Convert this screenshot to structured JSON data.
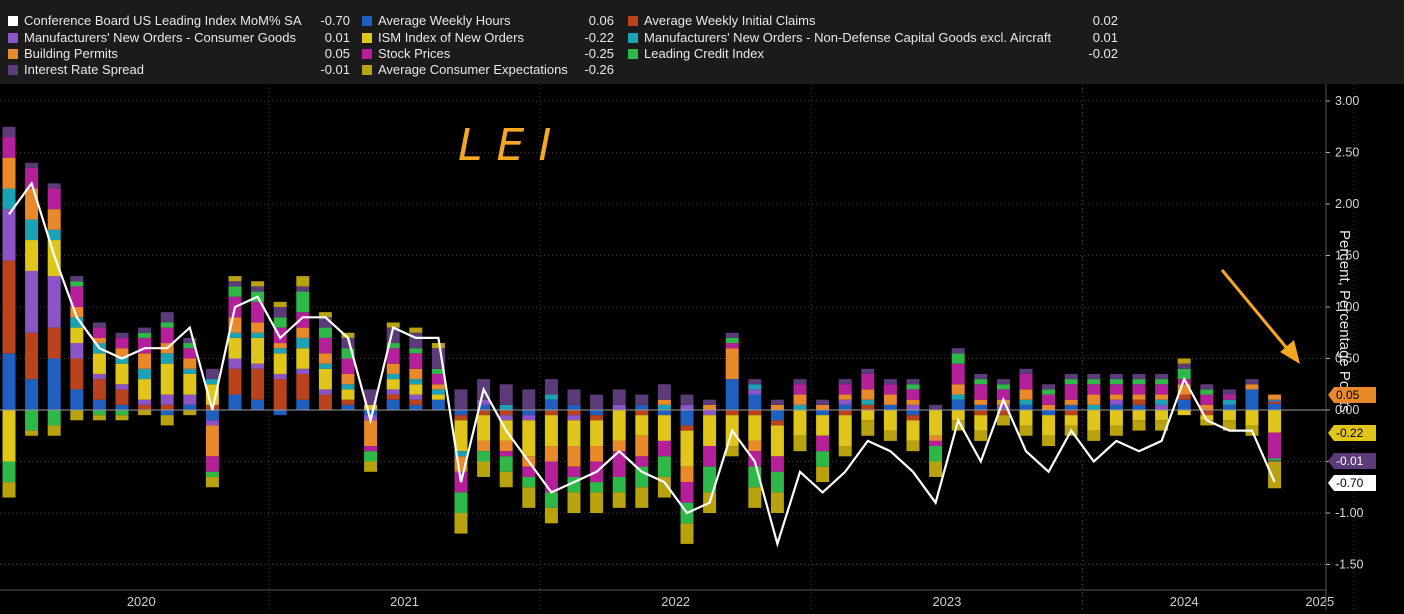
{
  "legend": [
    {
      "name": "Conference Board US Leading Index MoM% SA",
      "value": "-0.70",
      "color": "#ffffff"
    },
    {
      "name": "Average Weekly Hours",
      "value": "0.06",
      "color": "#1f5fbf"
    },
    {
      "name": "Average Weekly Initial Claims",
      "value": "0.02",
      "color": "#b8431c"
    },
    {
      "name": "Manufacturers' New Orders - Consumer Goods",
      "value": "0.01",
      "color": "#8b55c6"
    },
    {
      "name": "ISM Index of New Orders",
      "value": "-0.22",
      "color": "#e0c51a"
    },
    {
      "name": "Manufacturers' New Orders - Non-Defense Capital Goods excl. Aircraft",
      "value": "0.01",
      "color": "#1ba3b5"
    },
    {
      "name": "Building Permits",
      "value": "0.05",
      "color": "#e8892a"
    },
    {
      "name": "Stock Prices",
      "value": "-0.25",
      "color": "#b5209a"
    },
    {
      "name": "Leading Credit Index",
      "value": "-0.02",
      "color": "#2fb84a"
    },
    {
      "name": "Interest Rate Spread",
      "value": "-0.01",
      "color": "#5b3b78"
    },
    {
      "name": "Average Consumer Expectations",
      "value": "-0.26",
      "color": "#b8a20e"
    }
  ],
  "annotation": {
    "text": "LEI",
    "color": "#f5a623"
  },
  "value_tags": [
    {
      "text": "0.05",
      "value": 0.05,
      "bg": "#e8892a",
      "fg": "#000000"
    },
    {
      "text": "-0.22",
      "value": -0.22,
      "bg": "#e0c51a",
      "fg": "#000000"
    },
    {
      "text": "-0.01",
      "value": -0.01,
      "bg": "#5b3b78",
      "fg": "#ffffff"
    },
    {
      "text": "-0.70",
      "value": -0.7,
      "bg": "#ffffff",
      "fg": "#000000"
    }
  ],
  "chart_data": {
    "type": "bar",
    "stacked": true,
    "ylabel": "Percent, Percentage Points",
    "ylim": [
      -1.7,
      3.1
    ],
    "yticks": [
      3.0,
      2.5,
      2.0,
      1.5,
      1.0,
      0.5,
      0.0,
      -0.5,
      -1.0,
      -1.5
    ],
    "ytick_labels": [
      "3.00",
      "2.50",
      "2.00",
      "1.50",
      "1.00",
      "0.50",
      "0.00",
      "-0.50",
      "-1.00",
      "-1.50"
    ],
    "x_start": "2020-01",
    "year_labels": [
      "2020",
      "2021",
      "2022",
      "2023",
      "2024",
      "2025"
    ],
    "grid": true,
    "line": {
      "name": "Conference Board US Leading Index MoM% SA",
      "values": [
        1.9,
        2.2,
        1.5,
        0.9,
        0.6,
        0.5,
        0.6,
        0.6,
        0.8,
        0.0,
        1.0,
        1.1,
        0.7,
        0.9,
        0.9,
        0.7,
        -0.1,
        0.8,
        0.7,
        0.7,
        -0.7,
        0.2,
        -0.2,
        -0.5,
        -0.8,
        -0.7,
        -0.6,
        -0.4,
        -0.6,
        -0.7,
        -1.0,
        -0.9,
        -0.2,
        -0.5,
        -1.3,
        -0.6,
        -0.8,
        -0.6,
        -0.3,
        -0.4,
        -0.6,
        -0.9,
        -0.1,
        -0.5,
        0.1,
        -0.4,
        -0.6,
        -0.2,
        -0.5,
        -0.3,
        -0.4,
        -0.3,
        0.3,
        -0.1,
        -0.2,
        -0.2,
        -0.7
      ]
    },
    "series": [
      {
        "name": "Average Weekly Hours",
        "values": [
          0.55,
          0.3,
          0.5,
          0.2,
          0.1,
          0.05,
          0.0,
          -0.05,
          0.05,
          -0.1,
          0.15,
          0.1,
          -0.05,
          0.1,
          0.0,
          0.05,
          -0.05,
          0.1,
          0.05,
          0.1,
          -0.05,
          0.05,
          0.0,
          -0.05,
          0.1,
          0.05,
          -0.05,
          0.0,
          0.05,
          -0.05,
          -0.15,
          0.0,
          0.3,
          0.15,
          -0.1,
          0.0,
          -0.05,
          0.05,
          0.0,
          0.05,
          -0.05,
          0.0,
          0.1,
          0.05,
          0.0,
          0.05,
          -0.05,
          0.05,
          0.0,
          0.05,
          0.05,
          0.0,
          0.1,
          0.0,
          0.05,
          0.2,
          0.06
        ]
      },
      {
        "name": "Average Weekly Initial Claims",
        "values": [
          0.9,
          0.45,
          0.3,
          0.3,
          0.2,
          0.15,
          0.05,
          0.05,
          0.0,
          0.05,
          0.25,
          0.3,
          0.3,
          0.25,
          0.15,
          0.05,
          0.0,
          0.05,
          0.05,
          0.0,
          -0.05,
          -0.05,
          -0.05,
          0.0,
          -0.05,
          -0.05,
          -0.05,
          0.0,
          -0.05,
          0.0,
          -0.05,
          0.0,
          -0.05,
          -0.05,
          -0.05,
          0.0,
          0.0,
          -0.05,
          0.05,
          0.0,
          -0.05,
          0.0,
          0.0,
          -0.05,
          -0.05,
          0.0,
          0.0,
          -0.05,
          0.0,
          0.0,
          0.05,
          0.0,
          0.05,
          -0.05,
          0.0,
          0.0,
          0.02
        ]
      },
      {
        "name": "Manufacturers' New Orders - Consumer Goods",
        "values": [
          0.5,
          0.6,
          0.5,
          0.15,
          0.05,
          0.05,
          0.05,
          0.1,
          0.1,
          -0.05,
          0.1,
          0.05,
          0.05,
          0.05,
          0.05,
          0.0,
          -0.05,
          0.05,
          0.05,
          0.0,
          0.0,
          0.05,
          -0.05,
          -0.05,
          0.0,
          -0.05,
          0.0,
          0.05,
          0.0,
          0.0,
          0.05,
          -0.05,
          0.0,
          0.05,
          0.0,
          0.0,
          0.0,
          0.05,
          0.0,
          0.0,
          0.05,
          0.0,
          0.0,
          0.0,
          0.05,
          0.0,
          0.0,
          0.0,
          0.0,
          0.05,
          0.0,
          0.05,
          0.0,
          0.0,
          0.0,
          0.0,
          0.01
        ]
      },
      {
        "name": "ISM Index of New Orders",
        "values": [
          -0.5,
          0.3,
          0.35,
          0.15,
          0.2,
          0.2,
          0.2,
          0.3,
          0.2,
          0.2,
          0.2,
          0.25,
          0.2,
          0.2,
          0.2,
          0.1,
          0.05,
          0.1,
          0.1,
          0.05,
          -0.3,
          -0.25,
          -0.2,
          -0.35,
          -0.3,
          -0.25,
          -0.25,
          -0.3,
          -0.2,
          -0.25,
          -0.35,
          -0.3,
          -0.3,
          -0.25,
          -0.3,
          -0.25,
          -0.2,
          -0.3,
          -0.1,
          -0.2,
          -0.2,
          -0.25,
          -0.1,
          -0.15,
          0.0,
          -0.15,
          -0.2,
          -0.1,
          -0.2,
          -0.15,
          -0.1,
          -0.1,
          -0.05,
          -0.05,
          -0.1,
          -0.15,
          -0.22
        ]
      },
      {
        "name": "Manufacturers' New Orders - Non-Defense Capital Goods excl. Aircraft",
        "values": [
          0.2,
          0.2,
          0.1,
          0.1,
          0.1,
          0.05,
          0.1,
          0.1,
          0.05,
          0.05,
          0.05,
          0.05,
          0.05,
          0.1,
          0.05,
          0.05,
          0.0,
          0.05,
          0.05,
          0.05,
          -0.05,
          0.0,
          0.05,
          0.0,
          0.05,
          0.0,
          0.0,
          0.0,
          0.0,
          0.05,
          0.0,
          0.0,
          0.0,
          0.05,
          0.0,
          0.05,
          0.0,
          0.0,
          0.05,
          0.0,
          0.0,
          0.0,
          0.05,
          0.0,
          0.0,
          0.05,
          0.0,
          0.0,
          0.05,
          0.0,
          0.0,
          0.05,
          0.0,
          0.0,
          0.05,
          0.0,
          0.01
        ]
      },
      {
        "name": "Building Permits",
        "values": [
          0.3,
          0.3,
          0.2,
          0.1,
          0.05,
          0.1,
          0.15,
          0.1,
          0.1,
          -0.3,
          0.15,
          0.1,
          0.05,
          0.1,
          0.1,
          0.1,
          -0.25,
          0.1,
          0.1,
          0.05,
          -0.15,
          -0.1,
          -0.1,
          -0.1,
          -0.15,
          -0.2,
          -0.15,
          -0.1,
          -0.2,
          0.05,
          -0.15,
          0.05,
          0.3,
          -0.1,
          0.05,
          0.1,
          0.05,
          0.05,
          0.1,
          0.1,
          0.05,
          -0.05,
          0.1,
          0.05,
          0.05,
          0.1,
          0.05,
          0.05,
          0.1,
          0.05,
          0.05,
          0.05,
          0.1,
          0.05,
          0.0,
          0.05,
          0.05
        ]
      },
      {
        "name": "Stock Prices",
        "values": [
          0.2,
          0.2,
          0.2,
          0.2,
          0.1,
          0.1,
          0.15,
          0.15,
          0.1,
          -0.15,
          0.2,
          0.2,
          0.15,
          0.15,
          0.15,
          0.15,
          -0.05,
          0.15,
          0.15,
          0.1,
          -0.2,
          0.0,
          -0.05,
          -0.1,
          -0.3,
          -0.1,
          -0.2,
          -0.25,
          -0.1,
          -0.15,
          -0.2,
          -0.2,
          0.05,
          -0.15,
          -0.15,
          0.1,
          -0.15,
          0.1,
          0.15,
          0.1,
          0.1,
          -0.05,
          0.2,
          0.15,
          0.1,
          0.15,
          0.1,
          0.15,
          0.1,
          0.1,
          0.1,
          0.1,
          0.05,
          0.1,
          0.05,
          0.0,
          -0.25
        ]
      },
      {
        "name": "Leading Credit Index",
        "values": [
          -0.2,
          -0.2,
          -0.15,
          0.05,
          -0.05,
          -0.05,
          0.05,
          0.05,
          0.05,
          -0.05,
          0.1,
          0.1,
          0.1,
          0.2,
          0.1,
          0.1,
          -0.1,
          0.05,
          0.05,
          0.05,
          -0.2,
          -0.1,
          -0.15,
          -0.1,
          -0.15,
          -0.15,
          -0.1,
          -0.15,
          -0.2,
          -0.2,
          -0.2,
          -0.25,
          0.05,
          -0.2,
          -0.2,
          0.0,
          -0.15,
          0.0,
          0.0,
          0.0,
          0.05,
          -0.15,
          0.1,
          0.05,
          0.05,
          0.0,
          0.05,
          0.05,
          0.05,
          0.05,
          0.05,
          0.05,
          0.1,
          0.05,
          0.0,
          0.0,
          -0.02
        ]
      },
      {
        "name": "Interest Rate Spread",
        "values": [
          0.1,
          0.05,
          0.05,
          0.05,
          0.05,
          0.05,
          0.05,
          0.1,
          0.05,
          0.1,
          0.05,
          0.05,
          0.1,
          0.05,
          0.1,
          0.1,
          0.15,
          0.15,
          0.15,
          0.2,
          0.2,
          0.2,
          0.2,
          0.2,
          0.15,
          0.15,
          0.15,
          0.15,
          0.1,
          0.15,
          0.1,
          0.05,
          0.05,
          0.05,
          0.05,
          0.05,
          0.05,
          0.05,
          0.05,
          0.05,
          0.05,
          0.05,
          0.05,
          0.05,
          0.05,
          0.05,
          0.05,
          0.05,
          0.05,
          0.05,
          0.05,
          0.05,
          0.05,
          0.05,
          0.05,
          0.05,
          -0.01
        ]
      },
      {
        "name": "Average Consumer Expectations",
        "values": [
          -0.15,
          -0.05,
          -0.1,
          -0.1,
          -0.05,
          -0.05,
          -0.05,
          -0.1,
          -0.05,
          -0.1,
          0.05,
          0.05,
          0.05,
          0.1,
          0.05,
          0.05,
          -0.1,
          0.05,
          0.05,
          0.05,
          -0.2,
          -0.15,
          -0.15,
          -0.2,
          -0.15,
          -0.2,
          -0.2,
          -0.15,
          -0.2,
          -0.2,
          -0.2,
          -0.2,
          -0.1,
          -0.2,
          -0.2,
          -0.15,
          -0.15,
          -0.1,
          -0.15,
          -0.1,
          -0.1,
          -0.15,
          -0.1,
          -0.1,
          -0.1,
          -0.1,
          -0.1,
          -0.1,
          -0.1,
          -0.1,
          -0.1,
          -0.1,
          0.05,
          -0.05,
          -0.1,
          -0.1,
          -0.26
        ]
      }
    ]
  }
}
